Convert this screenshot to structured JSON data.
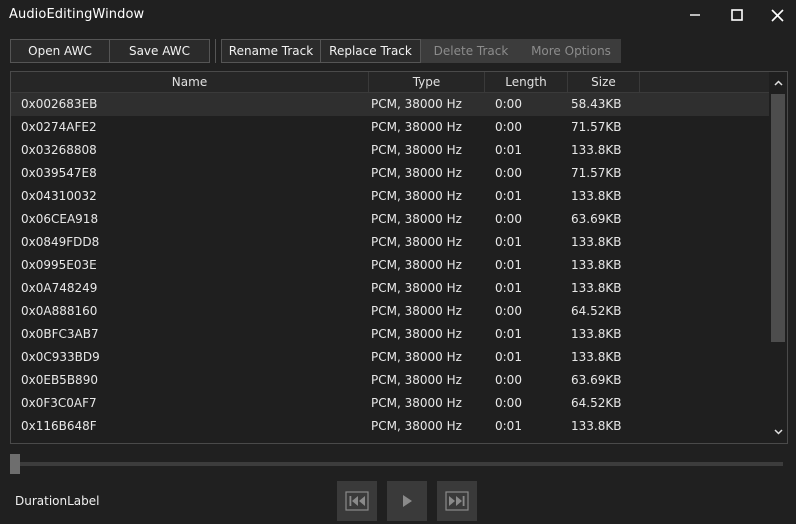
{
  "window": {
    "title": "AudioEditingWindow"
  },
  "toolbar": {
    "open_awc": "Open AWC",
    "save_awc": "Save AWC",
    "rename_track": "Rename Track",
    "replace_track": "Replace Track",
    "delete_track": "Delete Track",
    "more_options": "More Options"
  },
  "grid": {
    "columns": [
      "Name",
      "Type",
      "Length",
      "Size"
    ],
    "rows": [
      [
        "0x002683EB",
        "PCM, 38000 Hz",
        "0:00",
        "58.43KB"
      ],
      [
        "0x0274AFE2",
        "PCM, 38000 Hz",
        "0:00",
        "71.57KB"
      ],
      [
        "0x03268808",
        "PCM, 38000 Hz",
        "0:01",
        "133.8KB"
      ],
      [
        "0x039547E8",
        "PCM, 38000 Hz",
        "0:00",
        "71.57KB"
      ],
      [
        "0x04310032",
        "PCM, 38000 Hz",
        "0:01",
        "133.8KB"
      ],
      [
        "0x06CEA918",
        "PCM, 38000 Hz",
        "0:00",
        "63.69KB"
      ],
      [
        "0x0849FDD8",
        "PCM, 38000 Hz",
        "0:01",
        "133.8KB"
      ],
      [
        "0x0995E03E",
        "PCM, 38000 Hz",
        "0:01",
        "133.8KB"
      ],
      [
        "0x0A748249",
        "PCM, 38000 Hz",
        "0:01",
        "133.8KB"
      ],
      [
        "0x0A888160",
        "PCM, 38000 Hz",
        "0:00",
        "64.52KB"
      ],
      [
        "0x0BFC3AB7",
        "PCM, 38000 Hz",
        "0:01",
        "133.8KB"
      ],
      [
        "0x0C933BD9",
        "PCM, 38000 Hz",
        "0:01",
        "133.8KB"
      ],
      [
        "0x0EB5B890",
        "PCM, 38000 Hz",
        "0:00",
        "63.69KB"
      ],
      [
        "0x0F3C0AF7",
        "PCM, 38000 Hz",
        "0:00",
        "64.52KB"
      ],
      [
        "0x116B648F",
        "PCM, 38000 Hz",
        "0:01",
        "133.8KB"
      ]
    ],
    "selected_row": 0
  },
  "player": {
    "duration_label": "DurationLabel",
    "position": 0
  },
  "icons": {
    "minimize": "minimize-icon",
    "maximize": "maximize-icon",
    "close": "close-icon",
    "prev": "skip-previous-icon",
    "play": "play-icon",
    "next": "skip-next-icon"
  },
  "colors": {
    "background": "#202020",
    "button_bg": "#2b2b2b",
    "button_border": "#555555",
    "disabled_bg": "#3c3c3c",
    "disabled_text": "#8c8c8c",
    "selected_row": "#2f2f2f"
  }
}
